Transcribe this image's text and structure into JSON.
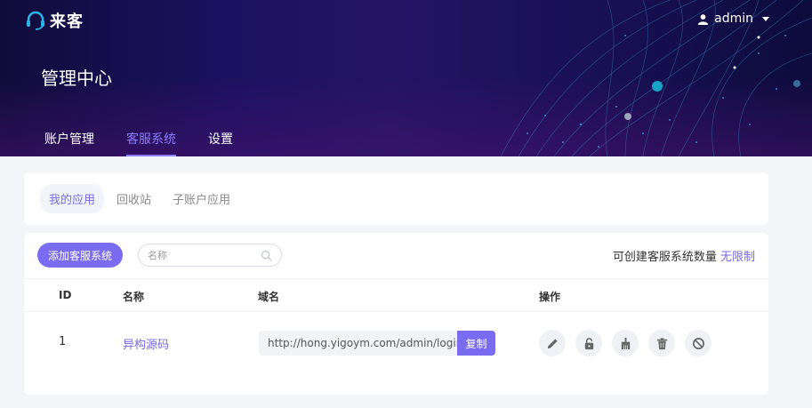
{
  "brand": {
    "name": "来客"
  },
  "user": {
    "name": "admin"
  },
  "page": {
    "title": "管理中心"
  },
  "nav": [
    {
      "label": "账户管理",
      "active": false
    },
    {
      "label": "客服系统",
      "active": true
    },
    {
      "label": "设置",
      "active": false
    }
  ],
  "subtabs": [
    {
      "label": "我的应用",
      "active": true
    },
    {
      "label": "回收站",
      "active": false
    },
    {
      "label": "子账户应用",
      "active": false
    }
  ],
  "toolbar": {
    "add_label": "添加客服系统",
    "search_placeholder": "名称",
    "search_value": "",
    "quota_label": "可创建客服系统数量",
    "quota_value": "无限制"
  },
  "table": {
    "headers": {
      "id": "ID",
      "name": "名称",
      "domain": "域名",
      "ops": "操作"
    },
    "rows": [
      {
        "id": "1",
        "name": "异构源码",
        "domain": "http://hong.yigoym.com/admin/login/in",
        "copy_label": "复制",
        "actions": [
          "edit-icon",
          "unlock-icon",
          "clean-brush-icon",
          "trash-icon",
          "disable-icon"
        ]
      }
    ]
  },
  "colors": {
    "accent": "#7a6cf0",
    "header_bg": "#1c1160"
  }
}
